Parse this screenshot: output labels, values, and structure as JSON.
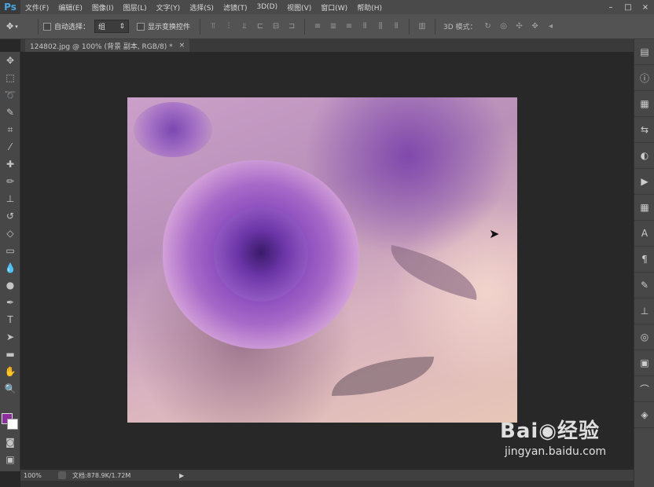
{
  "menubar": {
    "logo": "Ps",
    "items": [
      "文件(F)",
      "编辑(E)",
      "图像(I)",
      "图层(L)",
      "文字(Y)",
      "选择(S)",
      "滤镜(T)",
      "3D(D)",
      "视图(V)",
      "窗口(W)",
      "帮助(H)"
    ],
    "window_controls": [
      "–",
      "□",
      "×"
    ]
  },
  "options": {
    "auto_select_label": "自动选择：",
    "auto_select_value": "组",
    "show_transform_label": "显示变换控件",
    "mode_3d_label": "3D 模式："
  },
  "document": {
    "tab_title": "124802.jpg @ 100% (背景 副本, RGB/8) *",
    "tab_close": "×"
  },
  "status": {
    "zoom": "100%",
    "doc_info": "文档:878.9K/1.72M",
    "arrow": "▶"
  },
  "colors": {
    "foreground": "#8c2f9c",
    "background": "#ffffff"
  },
  "watermark": {
    "logo": "Bai◉经验",
    "url": "jingyan.baidu.com"
  }
}
